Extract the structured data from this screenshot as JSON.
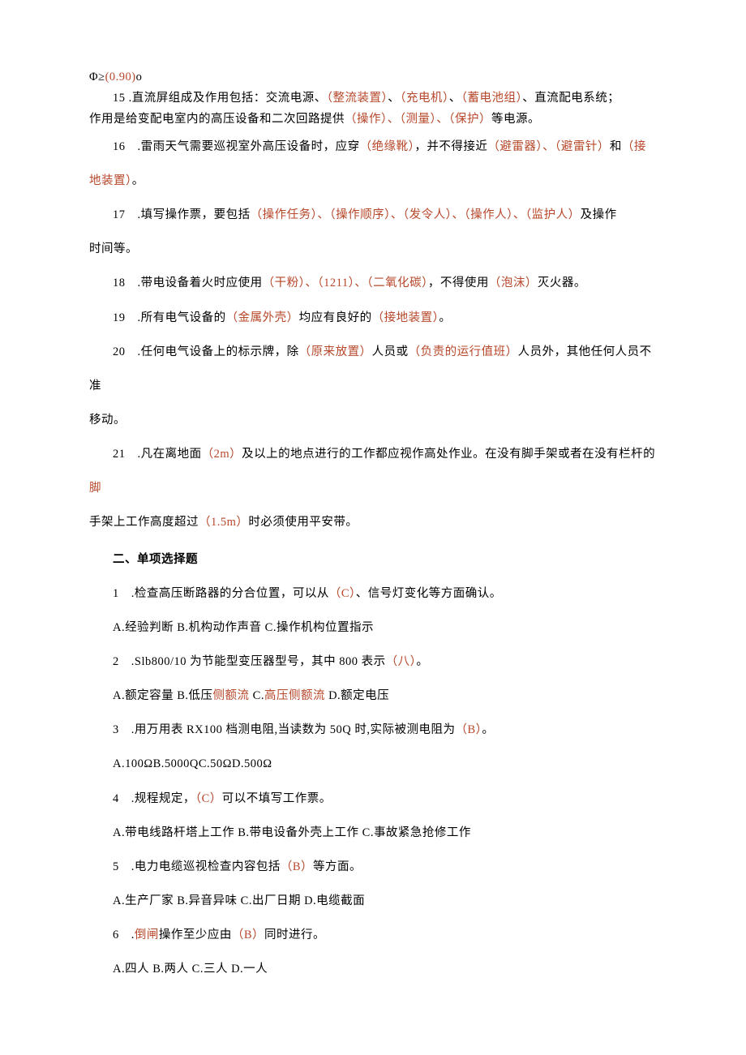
{
  "top": {
    "firstline_pre": "Φ≥",
    "firstline_ans": "(0.90)",
    "firstline_post": "o"
  },
  "fill": {
    "q15": {
      "pre": "15 .直流屏组成及作用包括：交流电源、",
      "a1": "（整流装置）",
      "m1": "、",
      "a2": "（充电机）",
      "m2": "、",
      "a3": "（蓄电池组）",
      "m3": "、直流配电系统；",
      "line2_pre": "作用是给变配电室内的高压设备和二次回路提供",
      "a4": "（操作）、（测量）、（保护）",
      "post": "等电源。"
    },
    "q16": {
      "pre": "16　.雷雨天气需要巡视室外高压设备时，应穿",
      "a1": "（绝缘靴）",
      "m1": "，并不得接近",
      "a2": "（避雷器）、（避雷针）",
      "m2": "和",
      "a3": "（接",
      "a3b": "地装置）",
      "post": "。"
    },
    "q17": {
      "pre": "17　.填写操作票，要包括",
      "a1": "（操作任务）、（操作顺序）、（发令人）、（操作人）、（监护人）",
      "post": "及操作",
      "line2": "时间等。"
    },
    "q18": {
      "pre": "18　.带电设备着火时应使用",
      "a1": "（干粉）、（1211）、（二氧化碳）",
      "m1": "，不得使用",
      "a2": "（泡沫）",
      "post": "灭火器。"
    },
    "q19": {
      "pre": "19　.所有电气设备的",
      "a1": "（金属外壳）",
      "m1": "均应有良好的",
      "a2": "（接地装置）",
      "post": "。"
    },
    "q20": {
      "pre": "20　.任何电气设备上的标示牌，除",
      "a1": "（原来放置）",
      "m1": "人员或",
      "a2": "（负责的运行值班）",
      "post": "人员外，其他任何人员不准",
      "line2": "移动。"
    },
    "q21": {
      "pre": "21　.凡在离地面",
      "a1": "（2m）",
      "m1": "及以上的地点进行的工作都应视作高处作业。在没有脚手架或者在没有栏杆的",
      "a2": "脚",
      "line2pre": "手架上工作高度超过",
      "a3": "（1.5m）",
      "post": "时必须使用平安带。"
    }
  },
  "section2_title": "二、单项选择题",
  "mc": {
    "q1": {
      "pre": "1　.检查高压断路器的分合位置，可以从",
      "ans": "（C）",
      "post": "、信号灯变化等方面确认。",
      "opts": "A.经验判断 B.机构动作声音 C.操作机构位置指示"
    },
    "q2": {
      "pre": "2　.Slb800/10 为节能型变压器型号，其中 800 表示",
      "ans": "（八）",
      "post": "。",
      "opts_a": "A.额定容量 B.低压",
      "opts_r1": "侧额流 ",
      "opts_b": "C.",
      "opts_r2": "高压侧额流 ",
      "opts_c": "D.额定电压"
    },
    "q3": {
      "pre": "3　.用万用表 RX100 档测电阻,当读数为 50Q 时,实际被测电阻为",
      "ans": "（B）",
      "post": "。",
      "opts": "A.100ΩB.5000QC.50ΩD.500Ω"
    },
    "q4": {
      "pre": "4　.规程规定，",
      "ans": "（C）",
      "post": "可以不填写工作票。",
      "opts": "A.带电线路杆塔上工作 B.带电设备外壳上工作 C.事故紧急抢修工作"
    },
    "q5": {
      "pre": "5　.电力电缆巡视检查内容包括",
      "ans": "（B）",
      "post": "等方面。",
      "opts": "A.生产厂家 B.异音异味 C.出厂日期 D.电缆截面"
    },
    "q6": {
      "pre_a": "6　.",
      "pre_r": "倒闸",
      "pre_b": "操作至少应由",
      "ans": "（B）",
      "post": "同时进行。",
      "opts": "A.四人 B.两人 C.三人 D.一人"
    }
  }
}
